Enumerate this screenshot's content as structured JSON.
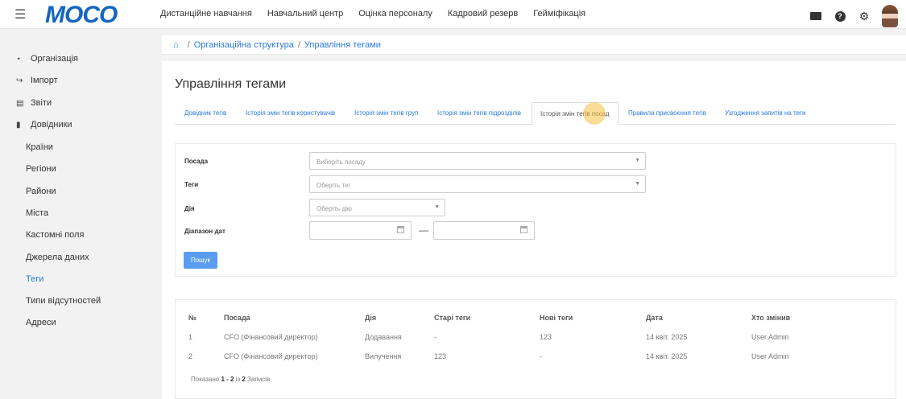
{
  "app": {
    "logo_text": "MOCO",
    "nav": [
      "Дистанційне навчання",
      "Навчальний центр",
      "Оцінка персоналу",
      "Кадровий резерв",
      "Гейміфікація"
    ],
    "icons": [
      "menu-icon",
      "envelope-icon",
      "help-icon",
      "gear-icon",
      "avatar"
    ]
  },
  "sidebar": {
    "items": [
      {
        "label": "Організація",
        "icon": "sitemap-icon"
      },
      {
        "label": "Імпорт",
        "icon": "import-icon"
      },
      {
        "label": "Звіти",
        "icon": "chart-icon"
      },
      {
        "label": "Довідники",
        "icon": "book-icon"
      }
    ],
    "sub_items": [
      "Країни",
      "Регіони",
      "Райони",
      "Міста",
      "Кастомні поля",
      "Джерела даних",
      "Теги",
      "Типи відсутностей",
      "Адреси"
    ],
    "active_sub": "Теги"
  },
  "breadcrumb": {
    "home_icon": "home-icon",
    "items": [
      "Організаційна структура",
      "Управління тегами"
    ]
  },
  "page": {
    "title": "Управління тегами",
    "tabs": [
      "Довідник тегів",
      "Історія змін тегів користувачів",
      "Історія змін тегів груп",
      "Історія змін тегів підрозділів",
      "Історія змін тегів посад",
      "Правила присвоєння тегів",
      "Узгодження запитів на теги"
    ],
    "active_tab": "Історія змін тегів посад"
  },
  "filter": {
    "position_label": "Посада",
    "position_placeholder": "Виберіть посаду",
    "tags_label": "Теги",
    "tags_placeholder": "Оберіть тег",
    "action_label": "Дія",
    "action_placeholder": "Оберіть дію",
    "date_range_label": "Діапазон дат",
    "date_separator": "—",
    "search_button": "Пошук"
  },
  "table": {
    "columns": [
      "№",
      "Посада",
      "Дія",
      "Старі теги",
      "Нові теги",
      "Дата",
      "Хто змінив"
    ],
    "rows": [
      [
        "1",
        "CFO (Фінансовий директор)",
        "Додавання",
        "-",
        "123",
        "14 квіт. 2025",
        "User Admin"
      ],
      [
        "2",
        "CFO (Фінансовий директор)",
        "Вилучення",
        "123",
        "-",
        "14 квіт. 2025",
        "User Admin"
      ]
    ],
    "info_prefix": "Показано",
    "info_range": "1 - 2",
    "info_mid": "із",
    "info_total": "2",
    "info_suffix": "Записів"
  },
  "colors": {
    "accent": "#2a7ae2",
    "button": "#5a9df0",
    "logo": "#1565c0",
    "cursor_highlight": "#f4bf40"
  }
}
